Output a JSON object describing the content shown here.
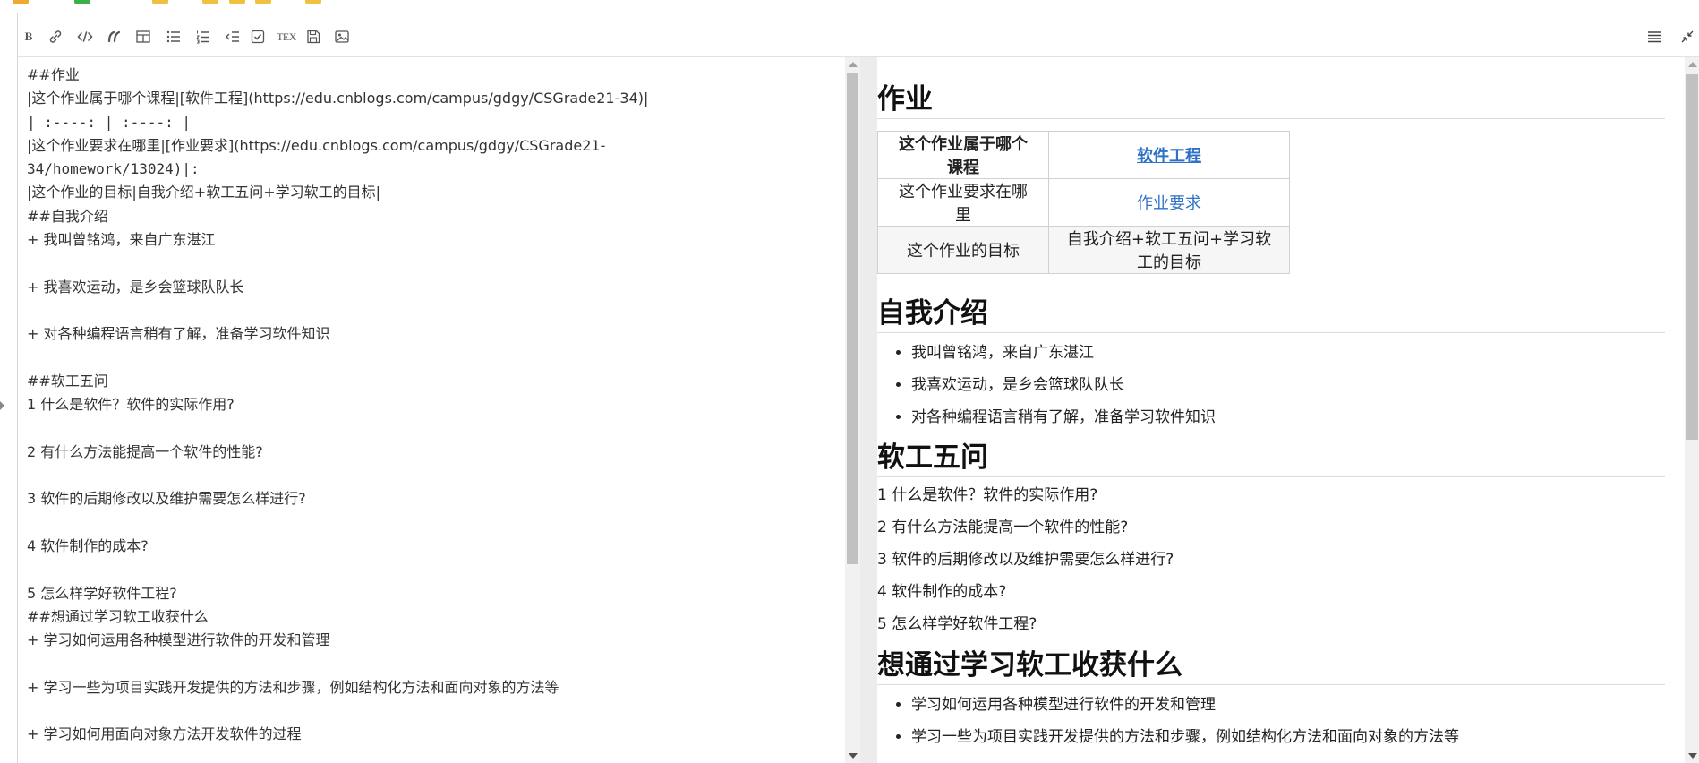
{
  "toolbar": {
    "buttons": [
      {
        "name": "bold-button",
        "icon": "bold-icon",
        "glyph": "B"
      },
      {
        "name": "link-button",
        "icon": "link-icon"
      },
      {
        "name": "code-button",
        "icon": "code-icon"
      },
      {
        "name": "quote-button",
        "icon": "quote-icon"
      },
      {
        "name": "table-button",
        "icon": "table-icon"
      },
      {
        "name": "unordered-list-button",
        "icon": "bullet-list-icon"
      },
      {
        "name": "ordered-list-button",
        "icon": "numbered-list-icon"
      },
      {
        "name": "outdent-button",
        "icon": "outdent-icon"
      },
      {
        "name": "task-list-button",
        "icon": "checkbox-icon"
      },
      {
        "name": "tex-button",
        "icon": "tex-icon",
        "glyph": "TEX"
      },
      {
        "name": "save-button",
        "icon": "save-icon"
      },
      {
        "name": "image-button",
        "icon": "image-icon"
      },
      {
        "name": "toc-button",
        "icon": "menu-icon"
      },
      {
        "name": "shrink-button",
        "icon": "collapse-icon"
      }
    ]
  },
  "source": {
    "lines": [
      "##作业",
      "|这个作业属于哪个课程|[软件工程](https://edu.cnblogs.com/campus/gdgy/CSGrade21-34)|",
      "| :----: | :----: |",
      "|这个作业要求在哪里|[作业要求](https://edu.cnblogs.com/campus/gdgy/CSGrade21-",
      "34/homework/13024)|:",
      "|这个作业的目标|自我介绍+软工五问+学习软工的目标|",
      "##自我介绍",
      "+ 我叫曾铭鸿，来自广东湛江",
      "",
      "+ 我喜欢运动，是乡会篮球队队长",
      "",
      "+ 对各种编程语言稍有了解，准备学习软件知识",
      "",
      "##软工五问",
      "1 什么是软件？软件的实际作用?",
      "",
      "2 有什么方法能提高一个软件的性能?",
      "",
      "3 软件的后期修改以及维护需要怎么样进行?",
      "",
      "4 软件制作的成本?",
      "",
      "5 怎么样学好软件工程?",
      "##想通过学习软工收获什么",
      "+ 学习如何运用各种模型进行软件的开发和管理",
      "",
      "+ 学习一些为项目实践开发提供的方法和步骤，例如结构化方法和面向对象的方法等",
      "",
      "+ 学习如何用面向对象方法开发软件的过程"
    ]
  },
  "preview": {
    "h_homework": "作业",
    "table": {
      "rows": [
        {
          "label": "这个作业属于哪个课程",
          "value": "软件工程",
          "link": true
        },
        {
          "label": "这个作业要求在哪里",
          "value": "作业要求",
          "link": true
        },
        {
          "label": "这个作业的目标",
          "value": "自我介绍+软工五问+学习软工的目标",
          "link": false
        }
      ]
    },
    "h_intro": "自我介绍",
    "intro_items": [
      "我叫曾铭鸿，来自广东湛江",
      "我喜欢运动，是乡会篮球队队长",
      "对各种编程语言稍有了解，准备学习软件知识"
    ],
    "h_questions": "软工五问",
    "questions": [
      "1 什么是软件？软件的实际作用?",
      "2 有什么方法能提高一个软件的性能?",
      "3 软件的后期修改以及维护需要怎么样进行?",
      "4 软件制作的成本?",
      "5 怎么样学好软件工程?"
    ],
    "h_goals": "想通过学习软工收获什么",
    "goals": [
      "学习如何运用各种模型进行软件的开发和管理",
      "学习一些为项目实践开发提供的方法和步骤，例如结构化方法和面向对象的方法等"
    ]
  }
}
